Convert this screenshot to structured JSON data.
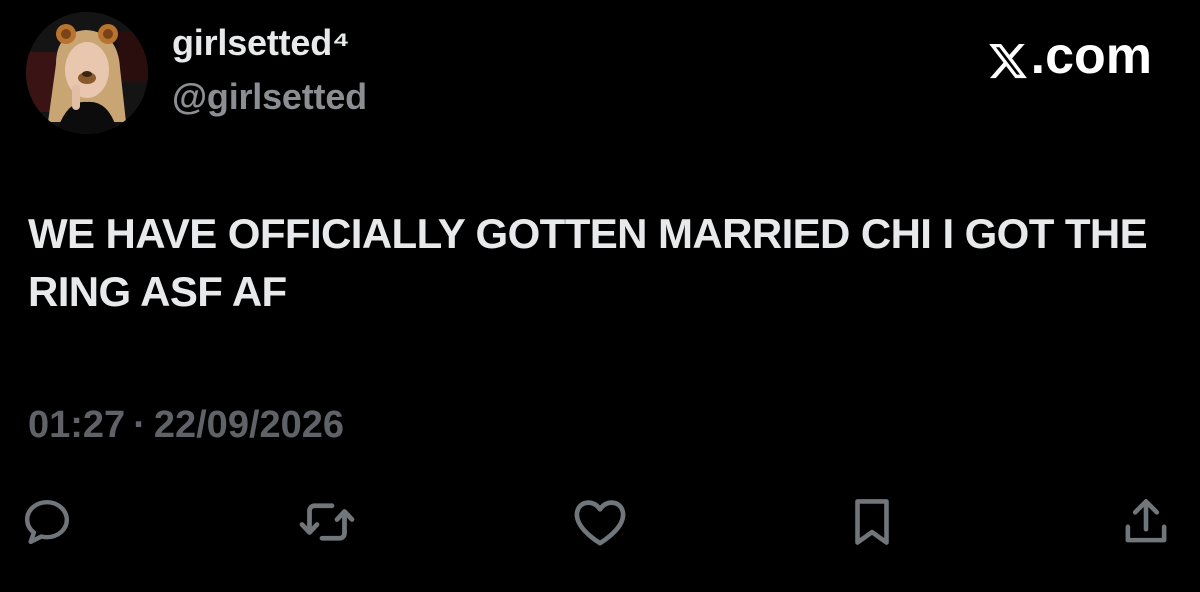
{
  "author": {
    "display_name": "girlsetted⁴",
    "handle": "@girlsetted",
    "avatar": "avatar-photo"
  },
  "brand": {
    "label": ".com",
    "logo_icon": "x-logo-icon"
  },
  "tweet": {
    "text": "WE HAVE OFFICIALLY GOTTEN MARRIED CHI I GOT THE RING ASF AF",
    "time": "01:27",
    "separator": "·",
    "date": "22/09/2026"
  },
  "actions": [
    {
      "name": "reply",
      "icon": "reply-icon"
    },
    {
      "name": "repost",
      "icon": "repost-icon"
    },
    {
      "name": "like",
      "icon": "heart-icon"
    },
    {
      "name": "bookmark",
      "icon": "bookmark-icon"
    },
    {
      "name": "share",
      "icon": "share-icon"
    }
  ],
  "colors": {
    "background": "#000000",
    "primary_text": "#e7e9ea",
    "secondary_text": "#8b8f94",
    "icon": "#71767b"
  }
}
